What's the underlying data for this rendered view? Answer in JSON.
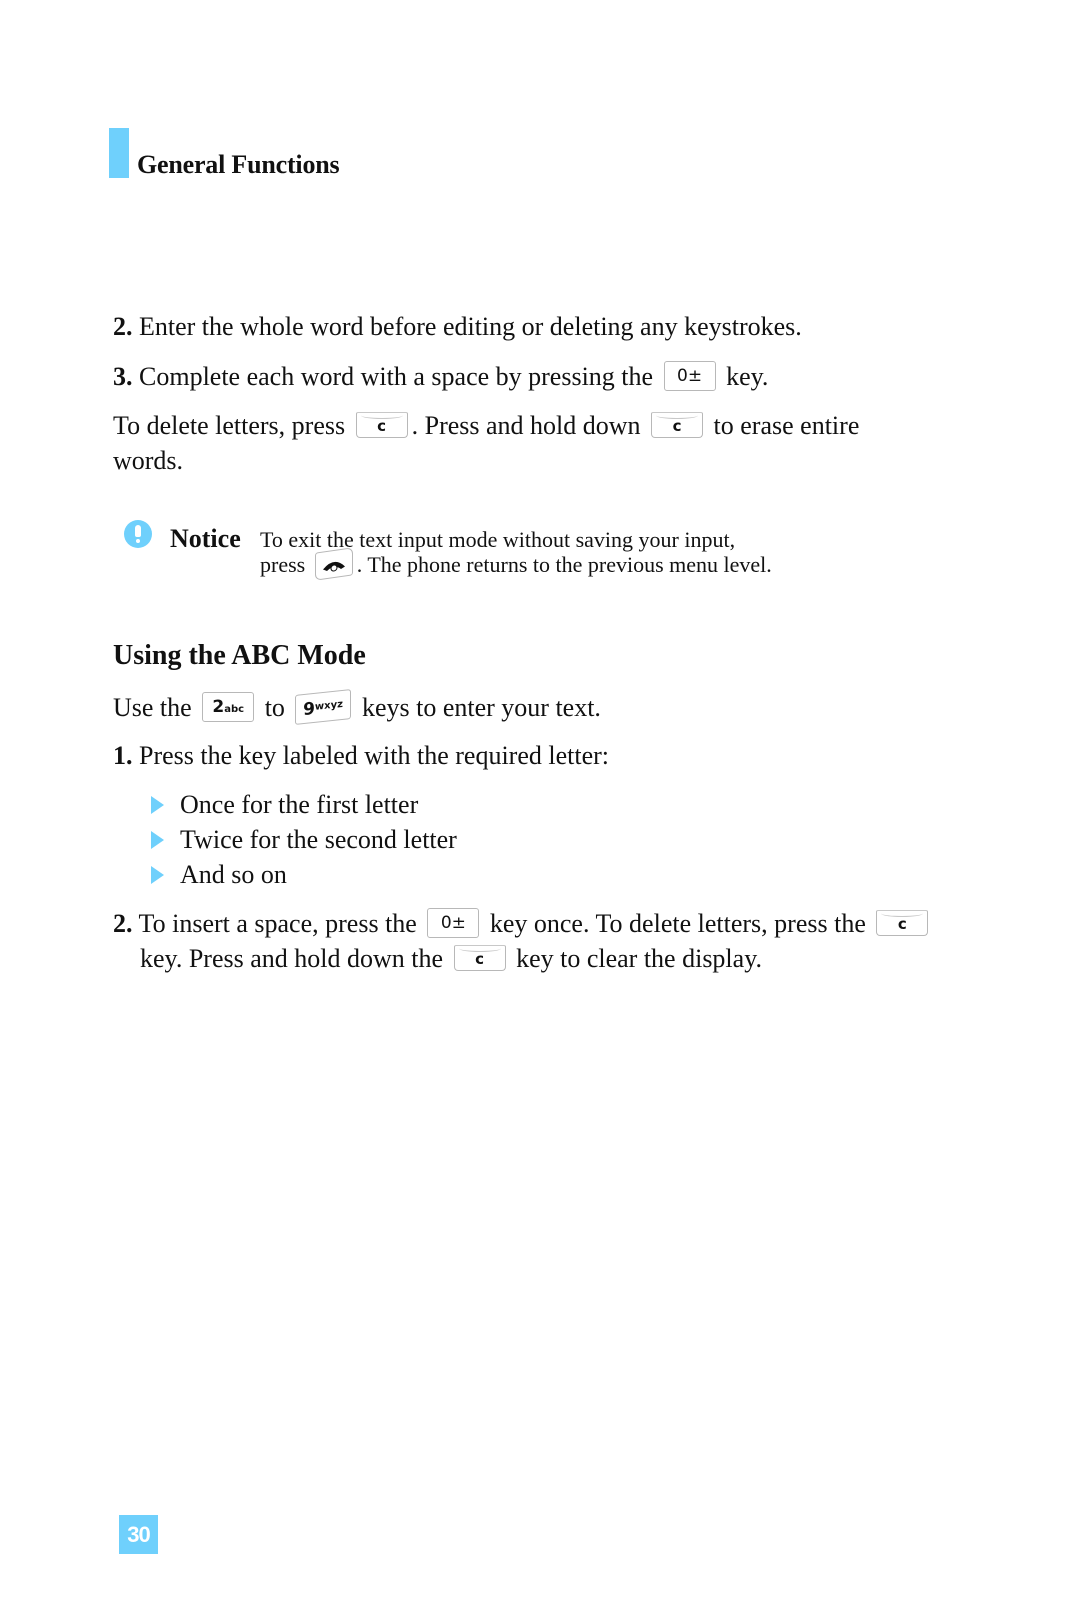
{
  "header": {
    "section_title": "General Functions",
    "accent_color": "#6fd0fc"
  },
  "steps_top": [
    {
      "number": "2.",
      "text": "Enter the whole word before editing or deleting any keystrokes."
    },
    {
      "number": "3.",
      "text_before": "Complete each word with a space by pressing the",
      "key": "0±",
      "text_after": "key."
    }
  ],
  "delete_paragraph": {
    "part1": "To delete letters, press",
    "key1": "c",
    "part2": ". Press and hold down",
    "key2": "c",
    "part3": "to erase entire",
    "part4": "words."
  },
  "notice": {
    "label": "Notice",
    "line1": "To exit the text input mode without saving your input,",
    "line2_before": "press",
    "line2_icon": "end-call-key",
    "line2_after": ". The phone returns to the previous menu level."
  },
  "abc_section": {
    "heading": "Using the ABC Mode",
    "intro_before": "Use the",
    "key_from_main": "2",
    "key_from_sub": "abc",
    "intro_mid": "to",
    "key_to_main": "9",
    "key_to_sub": "wxyz",
    "intro_after": "keys to enter your text.",
    "step1": {
      "number": "1.",
      "text": "Press the key labeled with the required letter:"
    },
    "bullets": [
      "Once for the first letter",
      "Twice for the second letter",
      "And so on"
    ],
    "step2": {
      "number": "2.",
      "part1": "To insert a space, press the",
      "key1": "0±",
      "part2": "key once. To delete letters, press the",
      "key2": "c",
      "part3": "key. Press and hold down the",
      "key3": "c",
      "part4": "key to clear the display."
    }
  },
  "footer": {
    "page_number": "30"
  }
}
